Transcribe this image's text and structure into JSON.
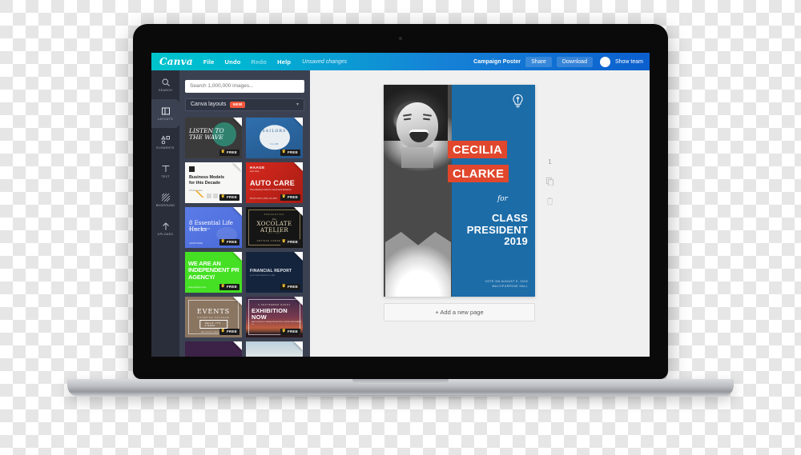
{
  "app": {
    "logo_text": "Canva",
    "menu": [
      {
        "label": "File",
        "dim": false
      },
      {
        "label": "Undo",
        "dim": false
      },
      {
        "label": "Redo",
        "dim": true
      },
      {
        "label": "Help",
        "dim": false
      }
    ],
    "save_status": "Unsaved changes",
    "document_title": "Campaign Poster",
    "share_label": "Share",
    "download_label": "Download",
    "show_team_label": "Show team",
    "accent_cyan": "#00C4CC",
    "accent_blue": "#0B5FCE"
  },
  "rail": {
    "items": [
      {
        "label": "SEARCH",
        "icon": "search-icon",
        "active": false
      },
      {
        "label": "LAYOUTS",
        "icon": "layouts-icon",
        "active": true
      },
      {
        "label": "ELEMENTS",
        "icon": "elements-icon",
        "active": false
      },
      {
        "label": "TEXT",
        "icon": "text-icon",
        "active": false
      },
      {
        "label": "BKGROUND",
        "icon": "background-icon",
        "active": false
      },
      {
        "label": "UPLOADS",
        "icon": "upload-icon",
        "active": false
      }
    ]
  },
  "panel": {
    "search_placeholder": "Search 1,000,000 images...",
    "search_value": "",
    "category_label": "Canva layouts",
    "category_badge": "NEW",
    "free_label": "FREE",
    "thumbnails": [
      {
        "id": "th1",
        "title": "LISTEN TO THE WAVE",
        "free": true
      },
      {
        "id": "th2",
        "title": "SAILORS",
        "subtitle": "A",
        "club": "CLUB",
        "est": "EST 1967",
        "free": true
      },
      {
        "id": "th3",
        "title": "Business Models for this Decade",
        "subtitle": "A Presentation",
        "free": true
      },
      {
        "id": "th4",
        "brand": "HAAGE",
        "brand_sub": "auto shop",
        "title": "AUTO CARE",
        "subtitle": "The industry's best in movement behavior",
        "foot": "BOOK NOW  |  (555) 123 4567",
        "free": true
      },
      {
        "id": "th5",
        "title": "8 Essential Life Hacks",
        "subtitle": "BY BEN MASON",
        "foot": "LEARN MORE",
        "free": true
      },
      {
        "id": "th6",
        "pre": "PRESENTING",
        "the": "the",
        "title": "XOCOLATE ATELIER",
        "est": "EST. 1962",
        "foot": "ARTISAN CONFECTIONS",
        "free": true
      },
      {
        "id": "th7",
        "title": "WE ARE AN INDEPENDENT PR AGENCY/",
        "foot": "www.pragency.com",
        "free": true
      },
      {
        "id": "th8",
        "title": "FINANCIAL REPORT",
        "subtitle": "by an inside discount co. elite",
        "free": true
      },
      {
        "id": "th9",
        "title": "EVENTS",
        "subtitle": "CATERING PACKAGE",
        "button": "HELLO, IT'S A MENU",
        "foot": "SEE OUR FULL MENU ONLINE",
        "free": true
      },
      {
        "id": "th10",
        "pre": "A SEPTEMBER EVENT",
        "title": "EXHIBITION NOW",
        "subtitle": "NEW WORKS BY EMERGING ARTISTS\nOPENS SEPTEMBER 14",
        "free": true
      },
      {
        "id": "th11",
        "title": "",
        "free": false
      },
      {
        "id": "th12",
        "title": "",
        "free": false
      }
    ]
  },
  "canvas": {
    "add_page_label": "+ Add a new page",
    "page_number": "1",
    "duplicate_icon": "duplicate-page-icon",
    "delete_icon": "delete-page-icon",
    "poster": {
      "bulb_icon": "lightbulb-icon",
      "first_name": "CECILIA",
      "last_name": "CLARKE",
      "connector": "for",
      "role_line1": "CLASS",
      "role_line2": "PRESIDENT",
      "role_line3": "2019",
      "footer_line1": "VOTE ON AUGUST 9, 2019",
      "footer_line2": "MULTIPURPOSE HALL",
      "color_bg": "#1C6CA8",
      "color_accent": "#E0472C"
    }
  }
}
